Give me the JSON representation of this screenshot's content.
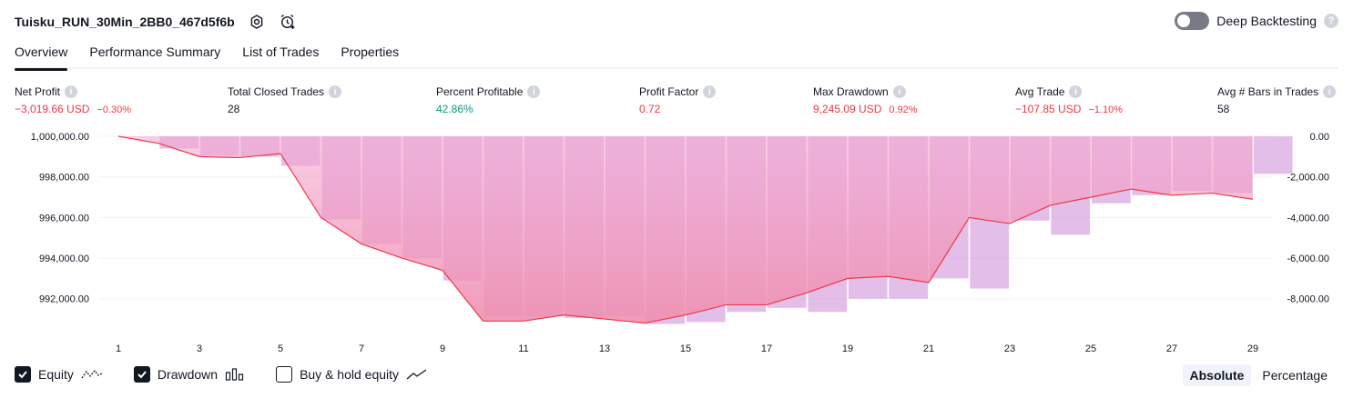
{
  "header": {
    "strategy_title": "Tuisku_RUN_30Min_2BB0_467d5f6b",
    "deep_backtesting_label": "Deep Backtesting",
    "help_glyph": "?"
  },
  "tabs": [
    {
      "label": "Overview",
      "active": true
    },
    {
      "label": "Performance Summary",
      "active": false
    },
    {
      "label": "List of Trades",
      "active": false
    },
    {
      "label": "Properties",
      "active": false
    }
  ],
  "metrics": [
    {
      "label": "Net Profit",
      "value": "−3,019.66 USD",
      "sub": "−0.30%",
      "tone": "neg"
    },
    {
      "label": "Total Closed Trades",
      "value": "28",
      "sub": "",
      "tone": "neutral"
    },
    {
      "label": "Percent Profitable",
      "value": "42.86%",
      "sub": "",
      "tone": "pos"
    },
    {
      "label": "Profit Factor",
      "value": "0.72",
      "sub": "",
      "tone": "neg"
    },
    {
      "label": "Max Drawdown",
      "value": "9,245.09 USD",
      "sub": "0.92%",
      "tone": "neg"
    },
    {
      "label": "Avg Trade",
      "value": "−107.85 USD",
      "sub": "−1.10%",
      "tone": "neg"
    },
    {
      "label": "Avg # Bars in Trades",
      "value": "58",
      "sub": "",
      "tone": "neutral"
    }
  ],
  "info_glyph": "i",
  "chart_data": {
    "type": "line",
    "x": [
      1,
      2,
      3,
      4,
      5,
      6,
      7,
      8,
      9,
      10,
      11,
      12,
      13,
      14,
      15,
      16,
      17,
      18,
      19,
      20,
      21,
      22,
      23,
      24,
      25,
      26,
      27,
      28,
      29
    ],
    "x_tick_labels": [
      "1",
      "3",
      "5",
      "7",
      "9",
      "11",
      "13",
      "15",
      "17",
      "19",
      "21",
      "23",
      "25",
      "27",
      "29"
    ],
    "left_axis": {
      "ylim": [
        990600,
        1000000
      ],
      "tick_labels": [
        "1,000,000.00",
        "998,000.00",
        "996,000.00",
        "994,000.00",
        "992,000.00"
      ],
      "tick_values": [
        1000000,
        998000,
        996000,
        994000,
        992000
      ]
    },
    "right_axis": {
      "ylim": [
        -9400,
        0
      ],
      "tick_labels": [
        "0.00",
        "-2,000.00",
        "-4,000.00",
        "-6,000.00",
        "-8,000.00"
      ],
      "tick_values": [
        0,
        -2000,
        -4000,
        -6000,
        -8000
      ]
    },
    "series": [
      {
        "name": "Equity",
        "color": "#f23645",
        "values": [
          1000000,
          999650,
          999000,
          998950,
          999150,
          996000,
          994700,
          994000,
          993400,
          990900,
          990900,
          991200,
          991000,
          990800,
          991200,
          991700,
          991700,
          992300,
          993000,
          993100,
          992800,
          996000,
          995700,
          996600,
          997000,
          997400,
          997100,
          997200,
          996900
        ]
      },
      {
        "name": "Drawdown",
        "color": "#ce93d8",
        "values": [
          0,
          -600,
          -950,
          -1000,
          -1450,
          -4100,
          -5300,
          -6000,
          -7100,
          -8850,
          -8850,
          -8950,
          -8850,
          -9245,
          -9150,
          -8650,
          -8450,
          -8650,
          -8000,
          -8000,
          -7000,
          -7500,
          -4150,
          -4850,
          -3300,
          -2900,
          -2700,
          -2800,
          -1850
        ]
      }
    ],
    "grid": true,
    "legend": "bottom-left"
  },
  "legend": {
    "equity_label": "Equity",
    "drawdown_label": "Drawdown",
    "buyhold_label": "Buy & hold equity",
    "equity_checked": true,
    "drawdown_checked": true,
    "buyhold_checked": false
  },
  "mode": {
    "absolute_label": "Absolute",
    "percentage_label": "Percentage",
    "active": "absolute"
  },
  "colors": {
    "negative": "#f23645",
    "positive": "#089981",
    "drawdown_bar": "#ce93d8",
    "equity_line": "#f23645",
    "equity_fill_top": "#f3a3cf",
    "equity_fill_bottom": "#ef8fae"
  },
  "icons": {
    "settings": "gear-icon",
    "alert": "alarm-add-icon",
    "equity_legend": "dashed-line-icon",
    "drawdown_legend": "bars-icon",
    "buyhold_legend": "line-icon"
  }
}
